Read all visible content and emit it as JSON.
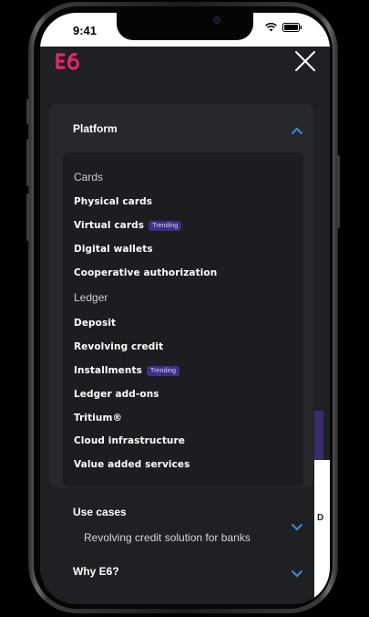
{
  "status_bar": {
    "time": "9:41"
  },
  "header": {
    "logo_text": "E6"
  },
  "platform": {
    "title": "Platform",
    "cards_label": "Cards",
    "ledger_label": "Ledger",
    "items": [
      {
        "label": "Physical cards"
      },
      {
        "label": "Virtual cards",
        "badge": "Trending"
      },
      {
        "label": "Digital wallets"
      },
      {
        "label": "Cooperative authorization"
      },
      {
        "label": "Deposit"
      },
      {
        "label": "Revolving credit"
      },
      {
        "label": "Installments",
        "badge": "Trending"
      },
      {
        "label": "Ledger add-ons"
      },
      {
        "label": "Tritium®"
      },
      {
        "label": "Cloud infrastructure"
      },
      {
        "label": "Value added services"
      }
    ]
  },
  "use_cases": {
    "title": "Use cases",
    "subtitle": "Revolving credit solution for banks"
  },
  "why": {
    "title": "Why E6?"
  },
  "peek": {
    "text": "D"
  },
  "colors": {
    "accent": "#e8236f",
    "chevron": "#3d8bd8",
    "badge_bg": "#3b2f86"
  }
}
